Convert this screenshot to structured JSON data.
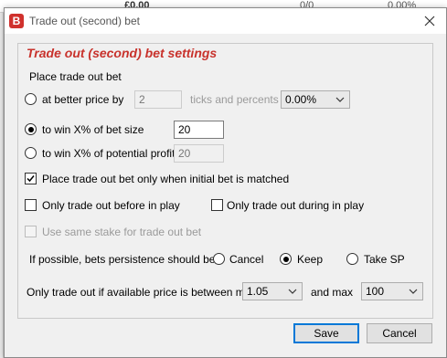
{
  "window": {
    "title": "Trade out (second) bet",
    "icon": "betfair-bot-icon",
    "close_icon": "close-icon"
  },
  "background": {
    "cell_a": "£0.00",
    "cell_b": "0/0",
    "cell_c": "0.00%"
  },
  "group": {
    "title": "Trade out (second) bet settings",
    "place_label": "Place trade out bet"
  },
  "options": {
    "better_price": {
      "label": "at better price by",
      "value": "2",
      "suffix": "ticks and percents",
      "percent": "0.00%",
      "selected": false
    },
    "win_bet_size": {
      "label": "to win X% of bet size",
      "value": "20",
      "selected": true
    },
    "win_profit": {
      "label": "to win X% of potential profit",
      "value": "20",
      "selected": false
    }
  },
  "checks": {
    "only_when_matched": {
      "label": "Place trade out bet only when initial bet is matched",
      "checked": true
    },
    "before_in_play": {
      "label": "Only trade out before in play",
      "checked": false
    },
    "during_in_play": {
      "label": "Only trade out during in play",
      "checked": false
    },
    "same_stake": {
      "label": "Use same stake for trade out bet",
      "checked": false,
      "disabled": true
    }
  },
  "persistence": {
    "label": "If possible, bets persistence should be:",
    "options": [
      "Cancel",
      "Keep",
      "Take SP"
    ],
    "selected": "Keep"
  },
  "price_range": {
    "label": "Only trade out if available price is between min",
    "min": "1.05",
    "max_label": "and max",
    "max": "100"
  },
  "buttons": {
    "save": "Save",
    "cancel": "Cancel"
  }
}
